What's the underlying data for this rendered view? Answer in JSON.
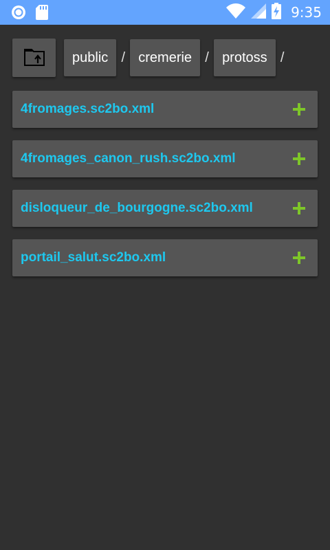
{
  "status_bar": {
    "time": "9:35",
    "icons": [
      "circle-notification-icon",
      "sd-card-icon",
      "wifi-icon",
      "cell-signal-icon",
      "battery-charging-icon"
    ]
  },
  "path": {
    "up_icon": "folder-up-icon",
    "crumbs": [
      "public",
      "cremerie",
      "protoss"
    ],
    "separator": "/"
  },
  "files": [
    {
      "name": "4fromages.sc2bo.xml",
      "action_icon": "plus-icon"
    },
    {
      "name": "4fromages_canon_rush.sc2bo.xml",
      "action_icon": "plus-icon"
    },
    {
      "name": "disloqueur_de_bourgogne.sc2bo.xml",
      "action_icon": "plus-icon"
    },
    {
      "name": "portail_salut.sc2bo.xml",
      "action_icon": "plus-icon"
    }
  ],
  "colors": {
    "status_bar": "#63a4fe",
    "background": "#303030",
    "card": "#555555",
    "file_name": "#1ec8ef",
    "add_icon": "#7ec629"
  }
}
